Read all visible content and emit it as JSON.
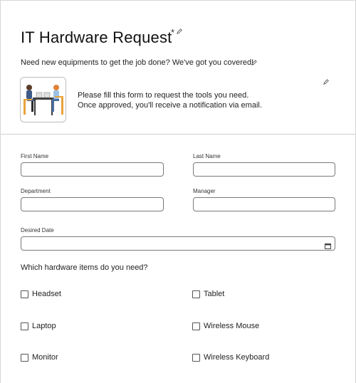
{
  "header": {
    "title": "IT Hardware Request",
    "required_mark": "*",
    "description": "Need new equipments to get the job done? We've got you covered!",
    "notice_line1": "Please fill this form to request the tools you need.",
    "notice_line2": "Once approved, you'll receive a notification via email.",
    "illustration_icon": "people-at-desk-illustration",
    "edit_icon": "pencil-icon"
  },
  "form": {
    "first_name": {
      "label": "First Name",
      "value": ""
    },
    "last_name": {
      "label": "Last Name",
      "value": ""
    },
    "department": {
      "label": "Department",
      "value": ""
    },
    "manager": {
      "label": "Manager",
      "value": ""
    },
    "desired_date": {
      "label": "Desired Date",
      "value": "",
      "icon": "calendar-icon"
    },
    "hardware_question": "Which hardware items do you need?",
    "hardware_options": [
      {
        "label": "Headset",
        "checked": false
      },
      {
        "label": "Tablet",
        "checked": false
      },
      {
        "label": "Laptop",
        "checked": false
      },
      {
        "label": "Wireless Mouse",
        "checked": false
      },
      {
        "label": "Monitor",
        "checked": false
      },
      {
        "label": "Wireless Keyboard",
        "checked": false
      }
    ]
  }
}
